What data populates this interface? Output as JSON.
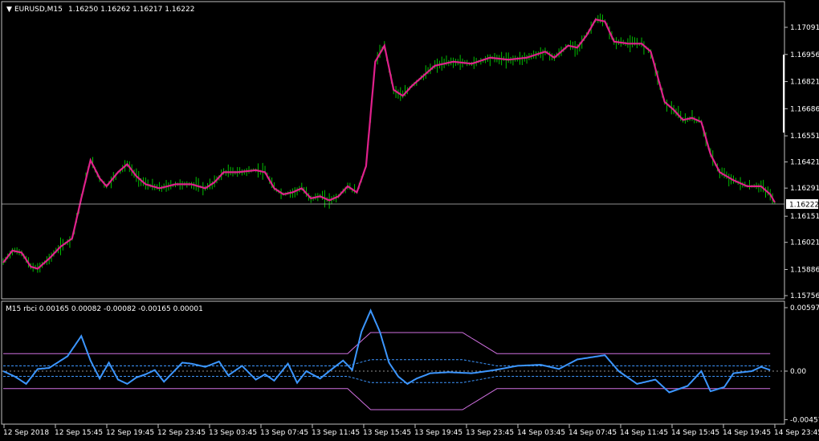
{
  "main_panel": {
    "title_arrow": "▼",
    "symbol_timeframe": "EURUSD,M15",
    "ohlc": "1.16250 1.16262 1.16217 1.16222",
    "current_price": "1.16222",
    "price_labels": [
      "1.17091",
      "1.16956",
      "1.16821",
      "1.16686",
      "1.16551",
      "1.16421",
      "1.16291",
      "1.16151",
      "1.16021",
      "1.15886",
      "1.15756"
    ]
  },
  "indicator_panel": {
    "header": "M15 rbci 0.00165 0.00082 -0.00082 -0.00165 0.00001",
    "scale_labels": [
      "0.00597",
      "0.00",
      "-0.00457"
    ]
  },
  "time_axis": {
    "labels": [
      "12 Sep 2018",
      "12 Sep 15:45",
      "12 Sep 19:45",
      "12 Sep 23:45",
      "13 Sep 03:45",
      "13 Sep 07:45",
      "13 Sep 11:45",
      "13 Sep 15:45",
      "13 Sep 19:45",
      "13 Sep 23:45",
      "14 Sep 03:45",
      "14 Sep 07:45",
      "14 Sep 11:45",
      "14 Sep 15:45",
      "14 Sep 19:45",
      "14 Sep 23:45"
    ]
  },
  "colors": {
    "background": "#000000",
    "grid_frame": "#c0c0c0",
    "bars": "#00c000",
    "price_ma": "#e0208c",
    "rbci": "#3c96ff",
    "bands_outer": "#d070e0",
    "bands_inner": "#3c96ff",
    "text": "#ffffff"
  },
  "chart_data": {
    "type": "line",
    "price_series": [
      [
        0,
        1.1592
      ],
      [
        4,
        1.1598
      ],
      [
        8,
        1.1597
      ],
      [
        12,
        1.159
      ],
      [
        15,
        1.1589
      ],
      [
        20,
        1.1594
      ],
      [
        25,
        1.16
      ],
      [
        30,
        1.1604
      ],
      [
        34,
        1.1624
      ],
      [
        38,
        1.1643
      ],
      [
        42,
        1.1634
      ],
      [
        45,
        1.163
      ],
      [
        50,
        1.1637
      ],
      [
        54,
        1.1641
      ],
      [
        58,
        1.1635
      ],
      [
        62,
        1.1631
      ],
      [
        68,
        1.1629
      ],
      [
        75,
        1.1631
      ],
      [
        82,
        1.1631
      ],
      [
        88,
        1.1629
      ],
      [
        92,
        1.1632
      ],
      [
        96,
        1.1637
      ],
      [
        102,
        1.1637
      ],
      [
        110,
        1.1638
      ],
      [
        114,
        1.1637
      ],
      [
        118,
        1.1629
      ],
      [
        122,
        1.1626
      ],
      [
        126,
        1.1627
      ],
      [
        130,
        1.1629
      ],
      [
        134,
        1.1624
      ],
      [
        138,
        1.1625
      ],
      [
        142,
        1.1623
      ],
      [
        146,
        1.1625
      ],
      [
        150,
        1.163
      ],
      [
        154,
        1.1627
      ],
      [
        158,
        1.164
      ],
      [
        162,
        1.1692
      ],
      [
        166,
        1.17
      ],
      [
        170,
        1.1678
      ],
      [
        174,
        1.1675
      ],
      [
        178,
        1.168
      ],
      [
        182,
        1.1684
      ],
      [
        188,
        1.169
      ],
      [
        196,
        1.1692
      ],
      [
        204,
        1.1691
      ],
      [
        212,
        1.1694
      ],
      [
        220,
        1.1693
      ],
      [
        228,
        1.1694
      ],
      [
        236,
        1.1697
      ],
      [
        240,
        1.1694
      ],
      [
        246,
        1.17
      ],
      [
        250,
        1.1699
      ],
      [
        254,
        1.1705
      ],
      [
        258,
        1.1713
      ],
      [
        262,
        1.1712
      ],
      [
        266,
        1.1702
      ],
      [
        272,
        1.1701
      ],
      [
        278,
        1.1701
      ],
      [
        282,
        1.1697
      ],
      [
        288,
        1.1672
      ],
      [
        292,
        1.1668
      ],
      [
        296,
        1.1663
      ],
      [
        300,
        1.1664
      ],
      [
        304,
        1.1662
      ],
      [
        308,
        1.1646
      ],
      [
        312,
        1.1637
      ],
      [
        318,
        1.1633
      ],
      [
        324,
        1.163
      ],
      [
        330,
        1.163
      ],
      [
        334,
        1.1626
      ],
      [
        336,
        1.1622
      ]
    ],
    "rbci_series": [
      [
        0,
        0.0
      ],
      [
        5,
        -0.0005
      ],
      [
        10,
        -0.0012
      ],
      [
        15,
        0.0002
      ],
      [
        20,
        0.0003
      ],
      [
        28,
        0.0014
      ],
      [
        34,
        0.0033
      ],
      [
        38,
        0.001
      ],
      [
        42,
        -0.0007
      ],
      [
        46,
        0.0008
      ],
      [
        50,
        -0.0008
      ],
      [
        54,
        -0.0012
      ],
      [
        58,
        -0.0006
      ],
      [
        62,
        -0.0003
      ],
      [
        66,
        0.0001
      ],
      [
        70,
        -0.001
      ],
      [
        74,
        -0.0001
      ],
      [
        78,
        0.0008
      ],
      [
        82,
        0.0007
      ],
      [
        88,
        0.0004
      ],
      [
        94,
        0.0009
      ],
      [
        98,
        -0.0004
      ],
      [
        104,
        0.0005
      ],
      [
        110,
        -0.0008
      ],
      [
        114,
        -0.0003
      ],
      [
        118,
        -0.0009
      ],
      [
        124,
        0.0007
      ],
      [
        128,
        -0.0011
      ],
      [
        132,
        0.0
      ],
      [
        138,
        -0.0007
      ],
      [
        142,
        0.0
      ],
      [
        148,
        0.001
      ],
      [
        152,
        0.0001
      ],
      [
        156,
        0.0037
      ],
      [
        160,
        0.0057
      ],
      [
        164,
        0.0037
      ],
      [
        168,
        0.0008
      ],
      [
        172,
        -0.0005
      ],
      [
        176,
        -0.0012
      ],
      [
        180,
        -0.0007
      ],
      [
        186,
        -0.0002
      ],
      [
        194,
        -0.0001
      ],
      [
        204,
        -0.0002
      ],
      [
        214,
        0.0001
      ],
      [
        224,
        0.0005
      ],
      [
        234,
        0.0006
      ],
      [
        242,
        0.0002
      ],
      [
        250,
        0.0011
      ],
      [
        262,
        0.0015
      ],
      [
        268,
        0.0
      ],
      [
        276,
        -0.0012
      ],
      [
        284,
        -0.0008
      ],
      [
        290,
        -0.002
      ],
      [
        298,
        -0.0014
      ],
      [
        304,
        0.0
      ],
      [
        308,
        -0.0019
      ],
      [
        314,
        -0.0015
      ],
      [
        318,
        -0.0002
      ],
      [
        326,
        0.0
      ],
      [
        330,
        0.0004
      ],
      [
        334,
        0.0001
      ]
    ],
    "bands": {
      "upper_outer": 0.00165,
      "upper_inner": 0.00082,
      "lower_inner": -0.00082,
      "lower_outer": -0.00165
    },
    "last_value": 1e-05
  }
}
